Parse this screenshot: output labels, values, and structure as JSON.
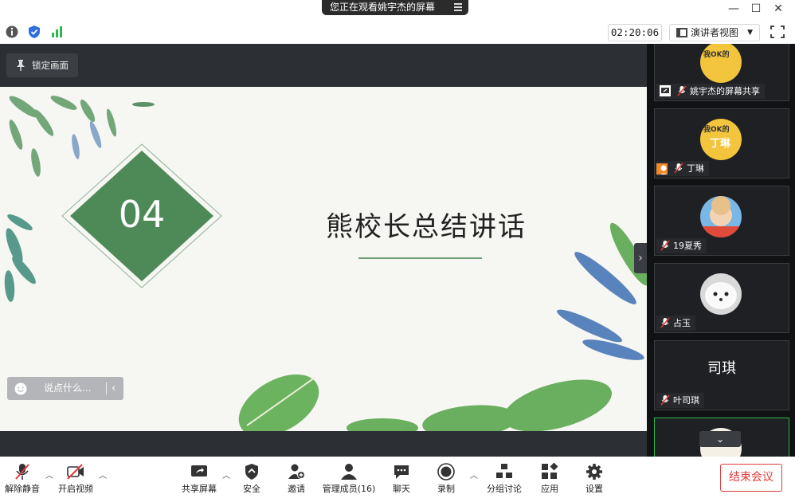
{
  "banner": {
    "text": "您正在观看姚宇杰的屏幕"
  },
  "toolbar": {
    "timer": "02:20:06",
    "view_label": "演讲者视图"
  },
  "main": {
    "lock_label": "锁定画面",
    "chat_placeholder": "说点什么..."
  },
  "slide": {
    "number": "04",
    "title": "熊校长总结讲话"
  },
  "participants": [
    {
      "name": "姚宇杰的屏幕共享",
      "avatar_text": "我OK的"
    },
    {
      "name": "丁琳",
      "avatar_text": "我OK的",
      "avatar_sub": "丁琳"
    },
    {
      "name": "19夏秀",
      "avatar_text": ""
    },
    {
      "name": "占玉",
      "avatar_text": ""
    },
    {
      "name": "叶司琪",
      "avatar_text": "司琪"
    }
  ],
  "bottom": {
    "unmute": "解除静音",
    "video": "开启视频",
    "share": "共享屏幕",
    "security": "安全",
    "invite": "邀请",
    "members": "管理成员(16)",
    "chat": "聊天",
    "record": "录制",
    "breakout": "分组讨论",
    "apps": "应用",
    "settings": "设置",
    "end": "结束会议"
  },
  "colors": {
    "accent_green": "#4e8a57",
    "end_red": "#e03b3b",
    "signal_green": "#2db84d",
    "shield_blue": "#2f6fe0"
  }
}
